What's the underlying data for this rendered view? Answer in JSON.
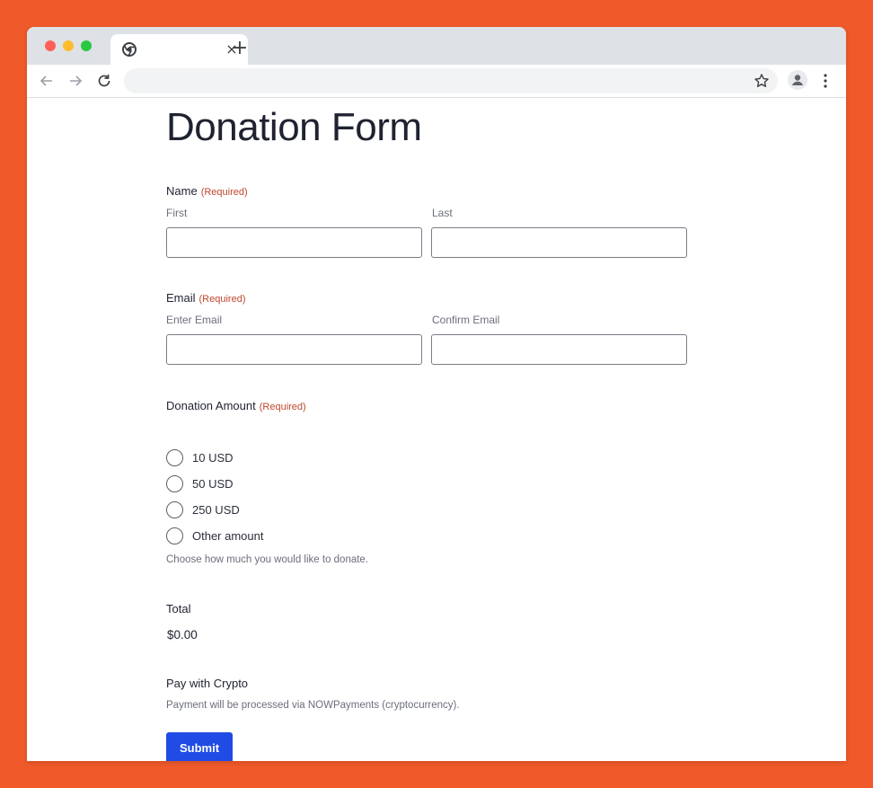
{
  "browser": {
    "tab_close": "×",
    "new_tab": "+"
  },
  "form": {
    "title": "Donation Form",
    "required_label": "(Required)",
    "name": {
      "label": "Name",
      "first_label": "First",
      "last_label": "Last",
      "first_value": "",
      "last_value": ""
    },
    "email": {
      "label": "Email",
      "enter_label": "Enter Email",
      "confirm_label": "Confirm Email",
      "enter_value": "",
      "confirm_value": ""
    },
    "donation": {
      "label": "Donation Amount",
      "options": [
        "10 USD",
        "50 USD",
        "250 USD",
        "Other amount"
      ],
      "help": "Choose how much you would like to donate."
    },
    "total": {
      "label": "Total",
      "value": "$0.00"
    },
    "crypto": {
      "label": "Pay with Crypto",
      "description": "Payment will be processed via NOWPayments (cryptocurrency)."
    },
    "submit_label": "Submit"
  },
  "colors": {
    "page_background": "#f05a2a",
    "required": "#c0472c",
    "submit": "#204ce5"
  }
}
